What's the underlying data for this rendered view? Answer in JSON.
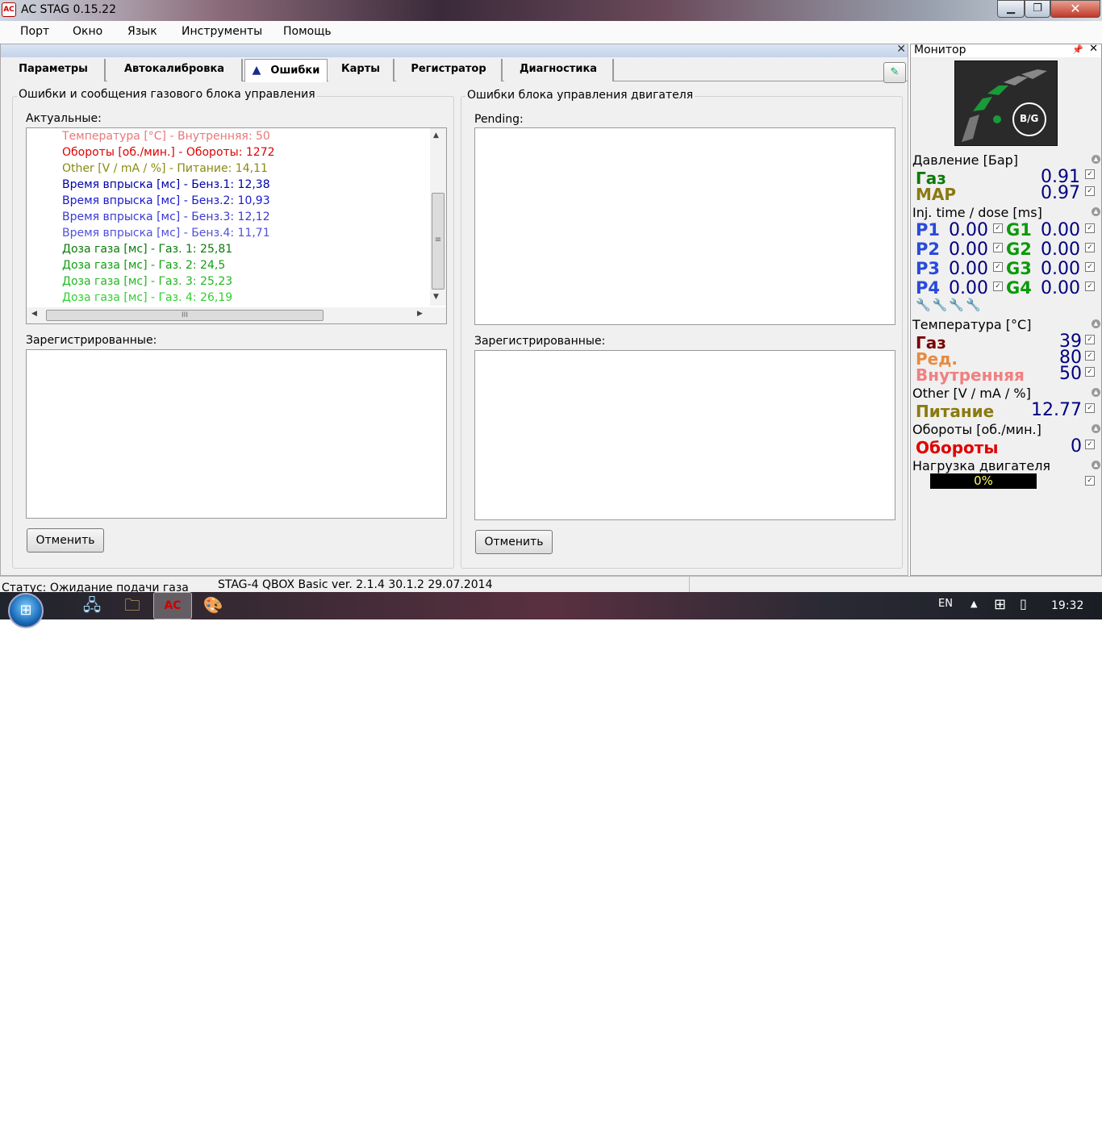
{
  "window": {
    "title": "AC STAG 0.15.22",
    "icon": "ac-stag-logo-icon"
  },
  "menu": [
    "Порт",
    "Окно",
    "Язык",
    "Инструменты",
    "Помощь"
  ],
  "tabs": [
    "Параметры",
    "Автокалибровка",
    "Ошибки",
    "Карты",
    "Регистратор",
    "Диагностика"
  ],
  "active_tab": "Ошибки",
  "gas_ecu": {
    "title": "Ошибки и сообщения газового блока управления",
    "actual_label": "Актуальные:",
    "actual_errors": [
      {
        "text": "Температура [°C] - Внутренняя: 50",
        "color": "#e87878"
      },
      {
        "text": "Обороты [об./мин.] - Обороты: 1272",
        "color": "#dd0000"
      },
      {
        "text": "Other [V / mA / %] - Питание: 14,11",
        "color": "#8a8a10"
      },
      {
        "text": "Время впрыска [мс] - Бенз.1: 12,38",
        "color": "#0000aa"
      },
      {
        "text": "Время впрыска [мс] - Бенз.2: 10,93",
        "color": "#1a1acc"
      },
      {
        "text": "Время впрыска [мс] - Бенз.3: 12,12",
        "color": "#3a3ad0"
      },
      {
        "text": "Время впрыска [мс] - Бенз.4: 11,71",
        "color": "#5050dd"
      },
      {
        "text": "Доза газа [мс] - Газ. 1: 25,81",
        "color": "#0a7a0a"
      },
      {
        "text": "Доза газа [мс] - Газ. 2: 24,5",
        "color": "#10a010"
      },
      {
        "text": "Доза газа [мс] - Газ. 3: 25,23",
        "color": "#20b820"
      },
      {
        "text": "Доза газа [мс] - Газ. 4: 26,19",
        "color": "#30d030"
      }
    ],
    "registered_label": "Зарегистрированные:",
    "cancel": "Отменить"
  },
  "engine_ecu": {
    "title": "Ошибки блока управления двигателя",
    "pending_label": "Pending:",
    "registered_label": "Зарегистрированные:",
    "cancel": "Отменить"
  },
  "monitor": {
    "title": "Монитор",
    "logo_text": "B/G",
    "pressure": {
      "label": "Давление [Бар]",
      "gas_name": "Газ",
      "gas_value": "0.91",
      "map_name": "MAP",
      "map_value": "0.97"
    },
    "inj": {
      "label": "Inj. time / dose [ms]",
      "rows": [
        {
          "p": "P1",
          "pv": "0.00",
          "g": "G1",
          "gv": "0.00"
        },
        {
          "p": "P2",
          "pv": "0.00",
          "g": "G2",
          "gv": "0.00"
        },
        {
          "p": "P3",
          "pv": "0.00",
          "g": "G3",
          "gv": "0.00"
        },
        {
          "p": "P4",
          "pv": "0.00",
          "g": "G4",
          "gv": "0.00"
        }
      ]
    },
    "temp": {
      "label": "Температура [°C]",
      "gas_name": "Газ",
      "gas_value": "39",
      "red_name": "Ред.",
      "red_value": "80",
      "int_name": "Внутренняя",
      "int_value": "50"
    },
    "other": {
      "label": "Other [V / mA / %]",
      "name": "Питание",
      "value": "12.77"
    },
    "rpm": {
      "label": "Обороты [об./мин.]",
      "name": "Обороты",
      "value": "0"
    },
    "load": {
      "label": "Нагрузка двигателя",
      "value": "0%"
    }
  },
  "status": {
    "left": "Статус: Ожидание подачи газа",
    "right": "STAG-4 QBOX Basic  ver. 2.1.4  30.1.2   29.07.2014 1:"
  },
  "taskbar": {
    "lang": "EN",
    "clock": "19:32"
  },
  "colors": {
    "green": "#0a7a0a",
    "olive": "#8a7a10",
    "navy": "#000080",
    "blue": "#2a4adc",
    "darkred": "#7a0000",
    "orange": "#e88a40",
    "salmon": "#f08080",
    "red": "#e00000"
  }
}
